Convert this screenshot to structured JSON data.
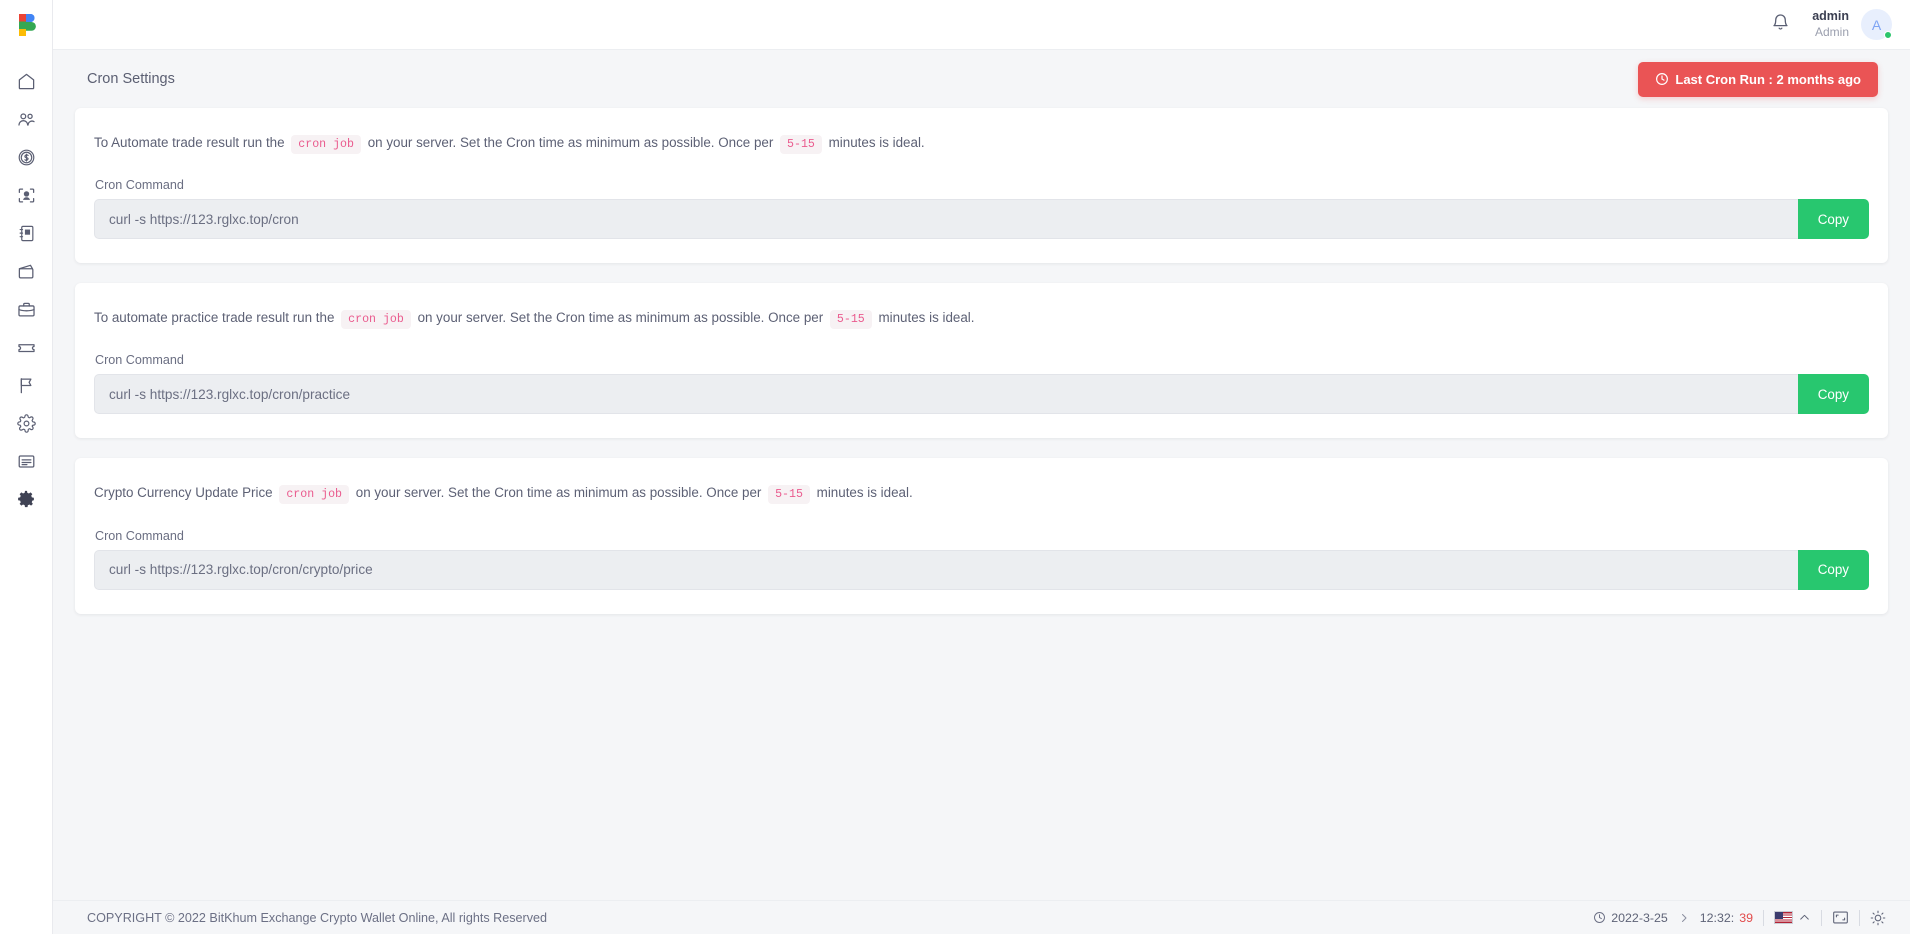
{
  "brand": {
    "logo_letter": "B"
  },
  "sidebar": {
    "items": [
      {
        "name": "home",
        "label": "Home",
        "icon": "home-icon",
        "active": false
      },
      {
        "name": "users",
        "label": "Users",
        "icon": "users-icon",
        "active": false
      },
      {
        "name": "finance",
        "label": "Finance",
        "icon": "dollar-coin-icon",
        "active": false
      },
      {
        "name": "kyc",
        "label": "KYC",
        "icon": "user-scan-icon",
        "active": false
      },
      {
        "name": "contacts",
        "label": "Contacts",
        "icon": "address-book-icon",
        "active": false
      },
      {
        "name": "wallet",
        "label": "Wallet",
        "icon": "wallet-icon",
        "active": false
      },
      {
        "name": "portfolio",
        "label": "Portfolio",
        "icon": "briefcase-icon",
        "active": false
      },
      {
        "name": "tickets",
        "label": "Tickets",
        "icon": "ticket-icon",
        "active": false
      },
      {
        "name": "reports",
        "label": "Reports",
        "icon": "flag-icon",
        "active": false
      },
      {
        "name": "preferences",
        "label": "Preferences",
        "icon": "gear-outline-icon",
        "active": false
      },
      {
        "name": "pages",
        "label": "Pages",
        "icon": "document-list-icon",
        "active": false
      },
      {
        "name": "settings",
        "label": "Settings",
        "icon": "gear-filled-icon",
        "active": true
      }
    ]
  },
  "header": {
    "notification_icon": "bell-icon",
    "user_name": "admin",
    "user_role": "Admin",
    "avatar_initial": "A",
    "status": "online"
  },
  "page": {
    "title": "Cron Settings",
    "last_run_button": {
      "label": "Last Cron Run : 2 months ago",
      "icon": "clock-icon",
      "color": "#ea5455"
    }
  },
  "cards": [
    {
      "desc_before": "To Automate trade result run the",
      "code_1": "cron job",
      "desc_middle": "on your server. Set the Cron time as minimum as possible. Once per",
      "code_2": "5-15",
      "desc_after": "minutes is ideal.",
      "field_label": "Cron Command",
      "command": "curl -s https://123.rglxc.top/cron",
      "copy_label": "Copy"
    },
    {
      "desc_before": "To automate practice trade result run the",
      "code_1": "cron job",
      "desc_middle": "on your server. Set the Cron time as minimum as possible. Once per",
      "code_2": "5-15",
      "desc_after": "minutes is ideal.",
      "field_label": "Cron Command",
      "command": "curl -s https://123.rglxc.top/cron/practice",
      "copy_label": "Copy"
    },
    {
      "desc_before": "Crypto Currency Update Price",
      "code_1": "cron job",
      "desc_middle": "on your server. Set the Cron time as minimum as possible. Once per",
      "code_2": "5-15",
      "desc_after": "minutes is ideal.",
      "field_label": "Cron Command",
      "command": "curl -s https://123.rglxc.top/cron/crypto/price",
      "copy_label": "Copy"
    }
  ],
  "footer": {
    "copyright": "COPYRIGHT © 2022 BitKhum Exchange Crypto Wallet Online, All rights Reserved",
    "date": "2022-3-25",
    "time_main": "12:32:",
    "time_seconds": "39",
    "language_flag": "us-flag-icon",
    "expand_icon": "chevron-up-icon",
    "fullscreen_icon": "fullscreen-icon",
    "brightness_icon": "sun-icon"
  },
  "colors": {
    "accent_red": "#ea5455",
    "accent_green": "#28c76f",
    "code_pink": "#ea5b8e"
  }
}
